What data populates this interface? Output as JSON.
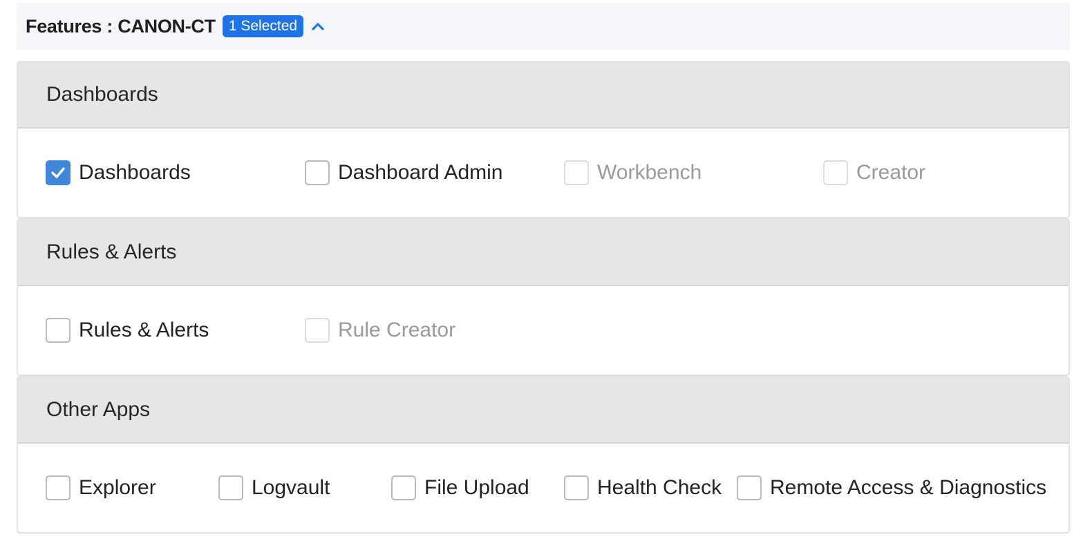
{
  "header": {
    "title": "Features : CANON-CT",
    "badge": "1 Selected"
  },
  "colors": {
    "accent": "#1f73e8",
    "checkbox_checked": "#3f86d8",
    "section_header_bg": "#e6e6e6",
    "disabled_text": "#9a9a9a"
  },
  "sections": [
    {
      "title": "Dashboards",
      "options": [
        {
          "label": "Dashboards",
          "checked": true,
          "disabled": false
        },
        {
          "label": "Dashboard Admin",
          "checked": false,
          "disabled": false
        },
        {
          "label": "Workbench",
          "checked": false,
          "disabled": true
        },
        {
          "label": "Creator",
          "checked": false,
          "disabled": true
        }
      ]
    },
    {
      "title": "Rules & Alerts",
      "options": [
        {
          "label": "Rules & Alerts",
          "checked": false,
          "disabled": false
        },
        {
          "label": "Rule Creator",
          "checked": false,
          "disabled": true
        }
      ]
    },
    {
      "title": "Other Apps",
      "options": [
        {
          "label": "Explorer",
          "checked": false,
          "disabled": false
        },
        {
          "label": "Logvault",
          "checked": false,
          "disabled": false
        },
        {
          "label": "File Upload",
          "checked": false,
          "disabled": false
        },
        {
          "label": "Health Check",
          "checked": false,
          "disabled": false
        },
        {
          "label": "Remote Access & Diagnostics",
          "checked": false,
          "disabled": false
        }
      ]
    }
  ]
}
